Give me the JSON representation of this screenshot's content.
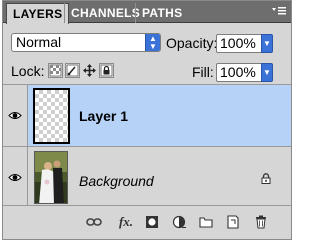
{
  "tabs": [
    {
      "label": "LAYERS",
      "active": true
    },
    {
      "label": "CHANNELS",
      "active": false
    },
    {
      "label": "PATHS",
      "active": false
    }
  ],
  "panel_menu_icon": "panel-menu-icon",
  "blend_mode": "Normal",
  "opacity_label": "Opacity:",
  "opacity_value": "100%",
  "lock_label": "Lock:",
  "fill_label": "Fill:",
  "fill_value": "100%",
  "layers": [
    {
      "name": "Layer 1",
      "selected": true,
      "visible": true,
      "thumb": "transparent-checkerboard"
    },
    {
      "name": "Background",
      "selected": false,
      "visible": true,
      "locked": true,
      "thumb": "wedding-photo"
    }
  ],
  "footer_icons": [
    "link-layers-icon",
    "fx-icon",
    "layer-mask-icon",
    "adjustment-layer-icon",
    "new-group-icon",
    "new-layer-icon",
    "trash-icon"
  ],
  "colors": {
    "accent": "#3a72d8",
    "selection": "#b6d3f7",
    "tabbar": "#6e6e6e",
    "panel": "#d6d6d6"
  }
}
